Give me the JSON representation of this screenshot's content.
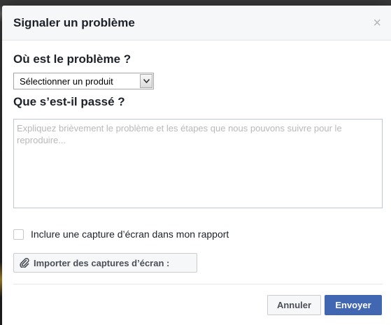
{
  "dialog": {
    "title": "Signaler un problème",
    "close_symbol": "×"
  },
  "where": {
    "label": "Où est le problème ?",
    "select_value": "Sélectionner un produit"
  },
  "what": {
    "label": "Que s’est-il passé ?",
    "placeholder": "Expliquez brièvement le problème et les étapes que nous pouvons suivre pour le reproduire..."
  },
  "screenshot": {
    "checkbox_label": "Inclure une capture d’écran dans mon rapport",
    "checkbox_checked": false,
    "import_label": "Importer des captures d’écran :"
  },
  "footer": {
    "cancel_label": "Annuler",
    "send_label": "Envoyer"
  },
  "colors": {
    "primary_button": "#4267b2",
    "header_bg": "#f6f7f9"
  },
  "icons": [
    "close-icon",
    "chevron-down-icon",
    "paperclip-icon"
  ]
}
